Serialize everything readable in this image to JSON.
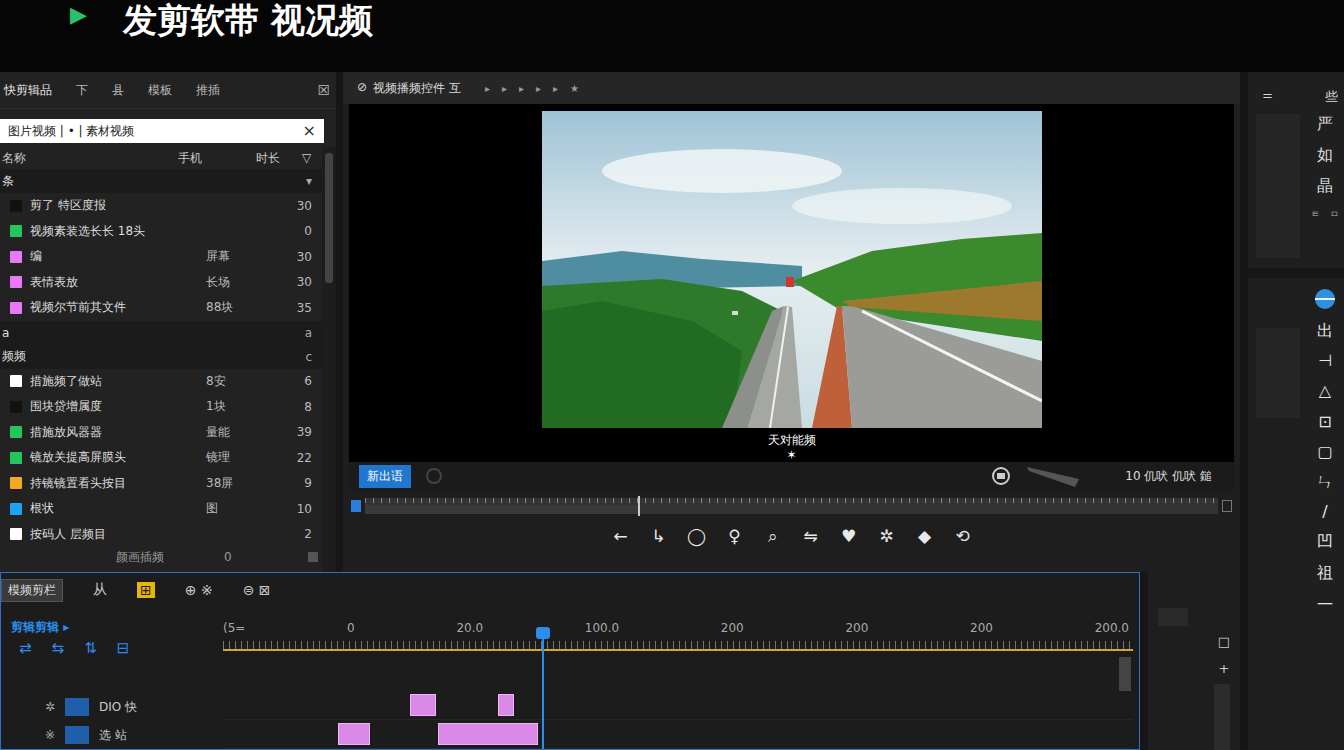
{
  "app_title": {
    "icon": "▶",
    "text": "发剪软带 视况频"
  },
  "media_panel": {
    "tabs": [
      {
        "label": "快剪辑品",
        "selected": true
      },
      {
        "label": "下",
        "selected": false
      },
      {
        "label": "县",
        "selected": false
      },
      {
        "label": "模板",
        "selected": false
      },
      {
        "label": "推插",
        "selected": false
      }
    ],
    "close": "☒",
    "search": {
      "value": "图片视频 | • | 素材视频",
      "clear": "×"
    },
    "columns": [
      "名称",
      "手机",
      "时长",
      "▽"
    ],
    "groups": [
      {
        "label": "条",
        "toggle": "▾",
        "items": [
          {
            "name": "剪了  特区度报",
            "duration": "30",
            "color": "#111111"
          },
          {
            "name": "视频素装选长长 18头",
            "duration": "0",
            "color": "#22c55e"
          },
          {
            "name": "编",
            "type": "屏幕",
            "duration": "30",
            "color": "#e879f9"
          },
          {
            "name": "表情表放",
            "type": "长场",
            "duration": "30",
            "color": "#e879f9"
          },
          {
            "name": "视频尔节前其文件",
            "type": "88块",
            "duration": "35",
            "color": "#e879f9"
          }
        ]
      },
      {
        "label": "a",
        "toggle": "a",
        "items": []
      },
      {
        "label": "频频",
        "toggle": "c",
        "items": [
          {
            "name": "措施频了做站",
            "type": "8安",
            "duration": "6",
            "color": "#ffffff"
          },
          {
            "name": "围块贷增属度",
            "type": "1块",
            "duration": "8",
            "color": "#111111"
          },
          {
            "name": "措施放风器器",
            "type": "量能",
            "duration": "39",
            "color": "#22c55e"
          },
          {
            "name": "镜放关提高屏膜头",
            "type": "镜理",
            "duration": "22",
            "color": "#22c55e"
          },
          {
            "name": "持镜镜置看头按目",
            "type": "38屏",
            "duration": "9",
            "color": "#f5a623"
          },
          {
            "name": "根状",
            "type": "图",
            "duration": "10",
            "color": "#1da1f2"
          },
          {
            "name": "按码人  层频目",
            "duration": "2",
            "color": "#ffffff"
          }
        ]
      }
    ],
    "footer": {
      "label": "颜画插频",
      "count": "0"
    }
  },
  "preview": {
    "title_icon": "⊘",
    "title": "视频播频控件 互",
    "arrows": [
      "▸",
      "▸",
      "▸",
      "▸",
      "▸",
      "★"
    ],
    "caption": "天对能频",
    "caption_mark": "✶",
    "mode_button": "新出语",
    "status_text": "10 仉吠 仉吠 鎚",
    "scrubber": {
      "level": 0.32
    },
    "transport": [
      "←",
      "↳",
      "◯",
      "♀",
      "⌕",
      "⇋",
      "♥",
      "✲",
      "◆",
      "⟲"
    ]
  },
  "timeline": {
    "button": "模频剪栏",
    "tools": [
      {
        "label": "从",
        "selected": false
      },
      {
        "label": "⊞",
        "selected": true
      },
      {
        "label": "⊕ ※",
        "selected": false
      },
      {
        "label": "⊜ ⊠",
        "selected": false
      }
    ],
    "header_label": "剪辑剪辑 ▸",
    "header_icons": [
      "⇄",
      "⇆",
      "⇅",
      "⊟"
    ],
    "ruler": [
      "(5=",
      "0",
      "20.0",
      "100.0",
      "200",
      "200",
      "200",
      "200.0"
    ],
    "playhead": 0.35,
    "tracks": [
      {
        "mark": "✲",
        "label": "DIO 快",
        "clips": [
          {
            "start": 0.205,
            "end": 0.234
          },
          {
            "start": 0.302,
            "end": 0.32
          }
        ]
      },
      {
        "mark": "※",
        "label": "选 站",
        "clips": [
          {
            "start": 0.126,
            "end": 0.162
          },
          {
            "start": 0.236,
            "end": 0.346
          }
        ]
      }
    ]
  },
  "mixer": {
    "items": [
      "□",
      "+"
    ]
  },
  "toolstrip": {
    "top": [
      "=",
      "些"
    ],
    "top_tools": [
      "严",
      "如",
      "晶"
    ],
    "top_small": [
      "ㅌ",
      "ㅁ"
    ],
    "tools": [
      "出",
      "⊣",
      "△",
      "⊡",
      "▢",
      "ㄣ",
      "/",
      "凹",
      "祖",
      "—"
    ]
  }
}
